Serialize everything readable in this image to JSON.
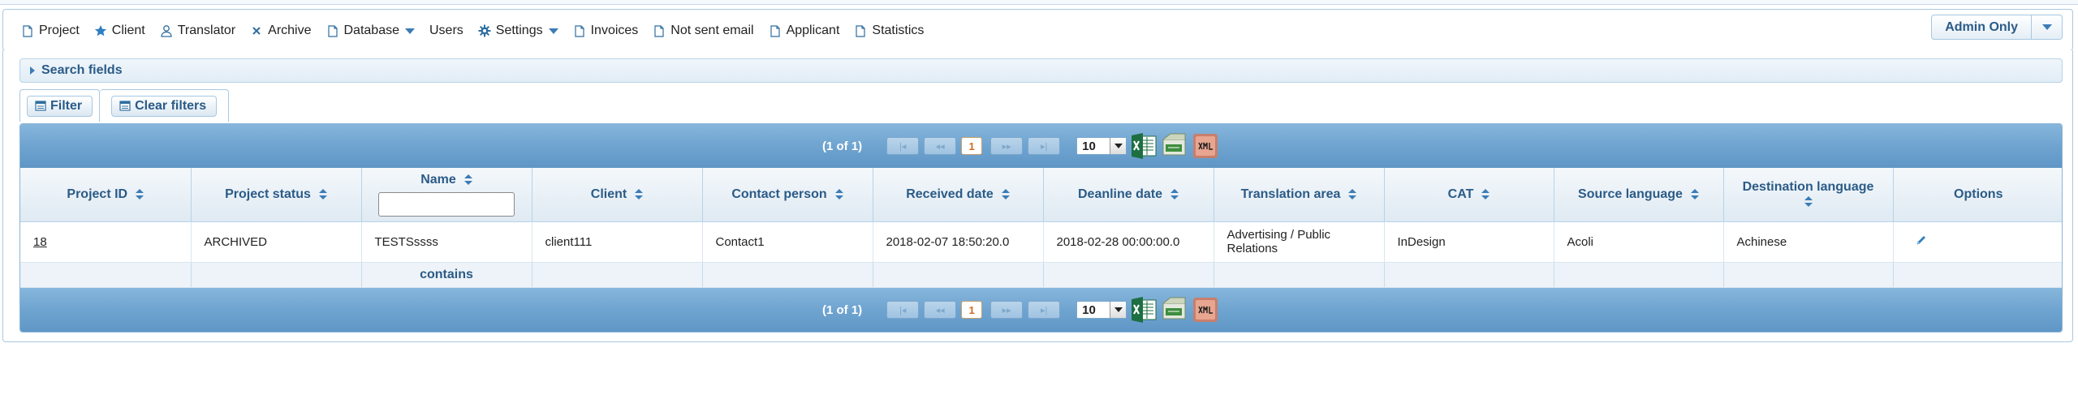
{
  "menu": {
    "items": [
      {
        "label": "Project",
        "icon": "page-icon"
      },
      {
        "label": "Client",
        "icon": "star-icon"
      },
      {
        "label": "Translator",
        "icon": "person-icon"
      },
      {
        "label": "Archive",
        "icon": "cross-icon"
      },
      {
        "label": "Database",
        "icon": "page-icon",
        "dropdown": true
      },
      {
        "label": "Users",
        "icon": ""
      },
      {
        "label": "Settings",
        "icon": "gear-icon",
        "dropdown": true
      },
      {
        "label": "Invoices",
        "icon": "page-icon"
      },
      {
        "label": "Not sent email",
        "icon": "page-icon"
      },
      {
        "label": "Applicant",
        "icon": "page-icon"
      },
      {
        "label": "Statistics",
        "icon": "page-icon"
      }
    ],
    "admin_label": "Admin Only"
  },
  "search": {
    "label": "Search fields"
  },
  "filters": {
    "filter_label": "Filter",
    "clear_label": "Clear filters"
  },
  "paginator": {
    "info": "(1 of 1)",
    "page": "1",
    "rows_per_page": "10"
  },
  "table": {
    "columns": [
      "Project ID",
      "Project status",
      "Name",
      "Client",
      "Contact person",
      "Received date",
      "Deanline date",
      "Translation area",
      "CAT",
      "Source language",
      "Destination language",
      "Options"
    ],
    "rows": [
      [
        "18",
        "ARCHIVED",
        "TESTSssss",
        "client111",
        "Contact1",
        "2018-02-07 18:50:20.0",
        "2018-02-28 00:00:00.0",
        "Advertising / Public Relations",
        "InDesign",
        "Acoli",
        "Achinese",
        ""
      ]
    ],
    "footer": "contains"
  },
  "colors": {
    "accent": "#2b5b87",
    "header_bar": "#6fa4d0",
    "border": "#a8c8e0"
  }
}
